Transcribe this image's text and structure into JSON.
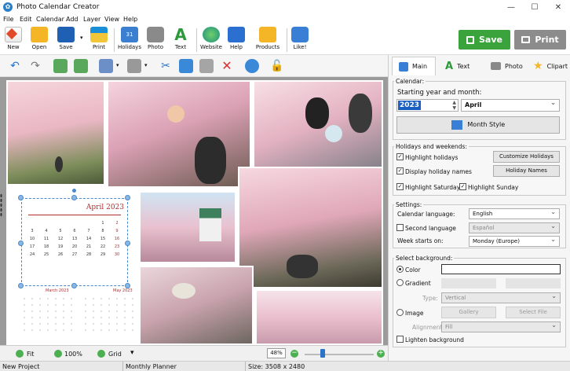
{
  "window": {
    "title": "Photo Calendar Creator"
  },
  "menu": [
    "File",
    "Edit",
    "Calendar",
    "Add",
    "Layer",
    "View",
    "Help"
  ],
  "toolbar": {
    "new": "New",
    "open": "Open",
    "save": "Save",
    "print": "Print",
    "holidays": "Holidays",
    "photo": "Photo",
    "text": "Text",
    "website": "Website",
    "help": "Help",
    "products": "Products",
    "like": "Like!",
    "save_big": "Save",
    "print_big": "Print"
  },
  "tabs": {
    "main": "Main",
    "text": "Text",
    "photo": "Photo",
    "clipart": "Clipart"
  },
  "calendar_section": {
    "title": "Calendar:",
    "start_label": "Starting year and month:",
    "year": "2023",
    "month": "April",
    "month_style": "Month Style"
  },
  "holidays_section": {
    "title": "Holidays and weekends:",
    "highlight_holidays": "Highlight holidays",
    "customize_holidays": "Customize Holidays",
    "display_holiday_names": "Display holiday names",
    "holiday_names": "Holiday Names",
    "highlight_saturday": "Highlight Saturday",
    "highlight_sunday": "Highlight Sunday"
  },
  "settings_section": {
    "title": "Settings:",
    "language_label": "Calendar language:",
    "language_value": "English",
    "second_language": "Second language",
    "second_language_value": "Español",
    "week_starts_label": "Week starts on:",
    "week_starts_value": "Monday (Europe)"
  },
  "background_section": {
    "title": "Select background:",
    "color": "Color",
    "gradient": "Gradient",
    "type_label": "Type:",
    "type_value": "Vertical",
    "image": "Image",
    "gallery": "Gallery",
    "select_file": "Select File",
    "alignment_label": "Alignment:",
    "alignment_value": "Fill",
    "lighten": "Lighten background"
  },
  "calendar_page": {
    "month_title": "April 2023",
    "days": [
      "",
      "",
      "",
      "",
      "",
      "1",
      "2",
      "3",
      "4",
      "5",
      "6",
      "7",
      "8",
      "9",
      "10",
      "11",
      "12",
      "13",
      "14",
      "15",
      "16",
      "17",
      "18",
      "19",
      "20",
      "21",
      "22",
      "23",
      "24",
      "25",
      "26",
      "27",
      "28",
      "29",
      "30"
    ],
    "prev_month": "March 2023",
    "next_month": "May 2023"
  },
  "bottom_bar": {
    "fit": "Fit",
    "zoom100": "100%",
    "grid": "Grid",
    "zoom": "48%"
  },
  "status": {
    "project": "New Project",
    "template": "Monthly Planner",
    "size": "Size: 3508 x 2480"
  },
  "colors": {
    "accent_green": "#3aa33c",
    "print_gray": "#8c8c8c",
    "calendar_red": "#b03030",
    "selection_blue": "#4a89c9"
  }
}
